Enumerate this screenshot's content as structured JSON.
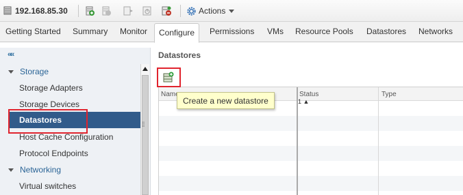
{
  "toolbar": {
    "host": "192.168.85.30",
    "actions_label": "Actions",
    "icons": [
      "host-icon",
      "add-host-icon",
      "remove-icon",
      "maintenance-icon",
      "power-icon",
      "new-datastore-icon",
      "settings-gear-icon"
    ]
  },
  "tabs": [
    {
      "label": "Getting Started"
    },
    {
      "label": "Summary"
    },
    {
      "label": "Monitor"
    },
    {
      "label": "Configure",
      "active": true
    },
    {
      "label": "Permissions"
    },
    {
      "label": "VMs"
    },
    {
      "label": "Resource Pools"
    },
    {
      "label": "Datastores"
    },
    {
      "label": "Networks"
    }
  ],
  "leftnav": {
    "collapse_glyph": "««",
    "storage_header": "Storage",
    "storage_items": [
      "Storage Adapters",
      "Storage Devices",
      "Datastores",
      "Host Cache Configuration",
      "Protocol Endpoints"
    ],
    "selected_item": "Datastores",
    "networking_header": "Networking",
    "networking_items": [
      "Virtual switches"
    ]
  },
  "main": {
    "title": "Datastores",
    "tooltip": "Create a new datastore",
    "columns": [
      "Name",
      "Status",
      "Type"
    ],
    "sort_indicator": "1 ▲"
  },
  "colors": {
    "selection": "#315b8a",
    "highlight": "#e0232d",
    "tooltip_bg": "#ffffcc",
    "nav_bg": "#eef1f5"
  }
}
